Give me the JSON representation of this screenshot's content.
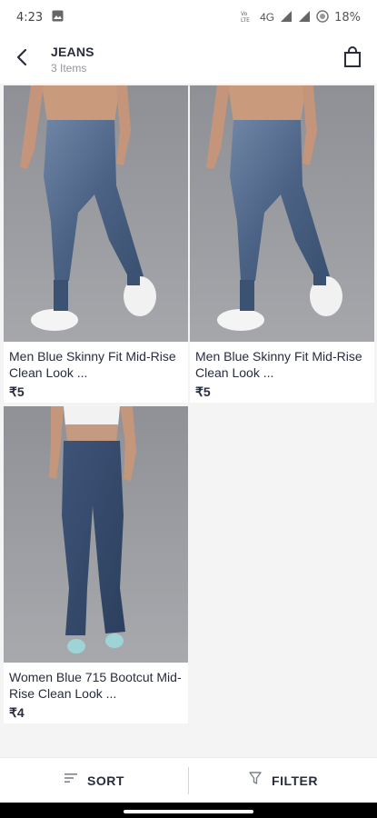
{
  "status_bar": {
    "time": "4:23",
    "network": "4G",
    "battery": "18%"
  },
  "header": {
    "title": "JEANS",
    "subtitle": "3 Items"
  },
  "products": [
    {
      "name": "Men Blue Skinny Fit Mid-Rise Clean Look ...",
      "price": "₹5"
    },
    {
      "name": "Men Blue Skinny Fit Mid-Rise Clean Look ...",
      "price": "₹5"
    },
    {
      "name": "Women Blue 715 Bootcut Mid-Rise Clean Look ...",
      "price": "₹4"
    }
  ],
  "bottom_bar": {
    "sort_label": "SORT",
    "filter_label": "FILTER"
  },
  "icons": {
    "back": "back-arrow-icon",
    "bag": "shopping-bag-icon",
    "sort": "sort-icon",
    "filter": "filter-funnel-icon"
  }
}
